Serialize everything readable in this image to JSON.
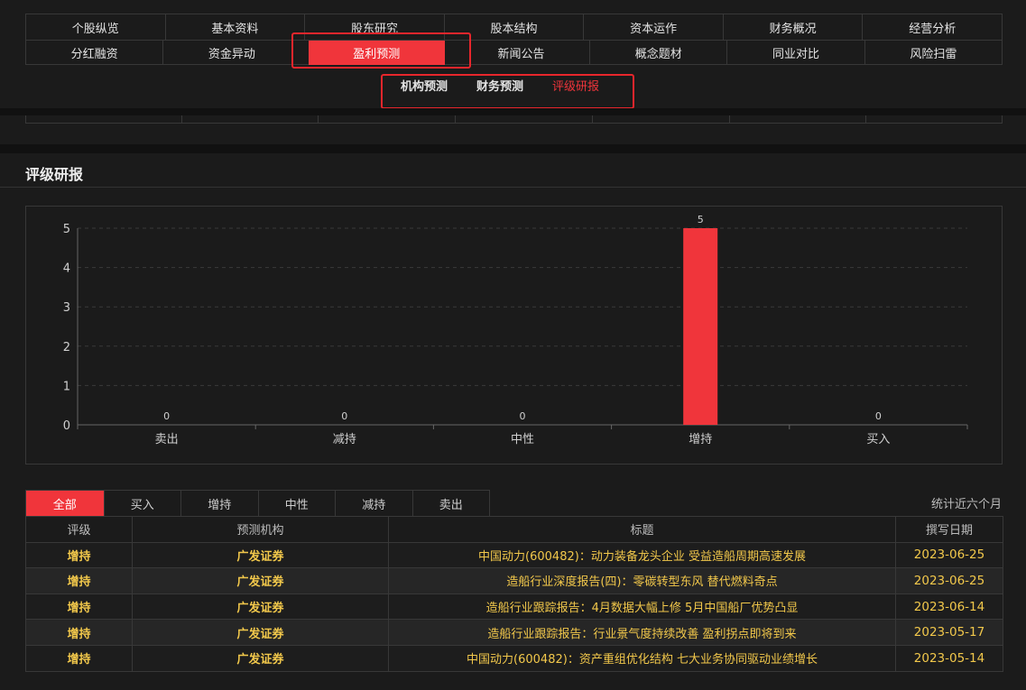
{
  "nav": {
    "row1": [
      "个股纵览",
      "基本资料",
      "股东研究",
      "股本结构",
      "资本运作",
      "财务概况",
      "经营分析"
    ],
    "row2": [
      "分红融资",
      "资金异动",
      "盈利预测",
      "新闻公告",
      "概念题材",
      "同业对比",
      "风险扫雷"
    ],
    "active": "盈利预测"
  },
  "subtabs": {
    "items": [
      "机构预测",
      "财务预测",
      "评级研报"
    ],
    "active": "评级研报"
  },
  "section": {
    "title": "评级研报"
  },
  "chart_data": {
    "type": "bar",
    "categories": [
      "卖出",
      "减持",
      "中性",
      "增持",
      "买入"
    ],
    "values": [
      0,
      0,
      0,
      5,
      0
    ],
    "data_labels": [
      "0",
      "0",
      "0",
      "5",
      "0"
    ],
    "ylim": [
      0,
      5
    ],
    "yticks": [
      "0",
      "1",
      "2",
      "3",
      "4",
      "5"
    ],
    "grid": true,
    "bar_color": "#f0353b"
  },
  "filter": {
    "tabs": [
      "全部",
      "买入",
      "增持",
      "中性",
      "减持",
      "卖出"
    ],
    "active": "全部",
    "note": "统计近六个月"
  },
  "table": {
    "headers": [
      "评级",
      "预测机构",
      "标题",
      "撰写日期"
    ],
    "rows": [
      {
        "rating": "增持",
        "org": "广发证券",
        "title": "中国动力(600482)：动力装备龙头企业 受益造船周期高速发展",
        "date": "2023-06-25"
      },
      {
        "rating": "增持",
        "org": "广发证券",
        "title": "造船行业深度报告(四)：零碳转型东风 替代燃料奇点",
        "date": "2023-06-25"
      },
      {
        "rating": "增持",
        "org": "广发证券",
        "title": "造船行业跟踪报告：4月数据大幅上修 5月中国船厂优势凸显",
        "date": "2023-06-14"
      },
      {
        "rating": "增持",
        "org": "广发证券",
        "title": "造船行业跟踪报告：行业景气度持续改善 盈利拐点即将到来",
        "date": "2023-05-17"
      },
      {
        "rating": "增持",
        "org": "广发证券",
        "title": "中国动力(600482)：资产重组优化结构 七大业务协同驱动业绩增长",
        "date": "2023-05-14"
      }
    ]
  },
  "colors": {
    "accent": "#f0353b",
    "text_yellow": "#f2c84b",
    "bg": "#1b1b1b"
  }
}
